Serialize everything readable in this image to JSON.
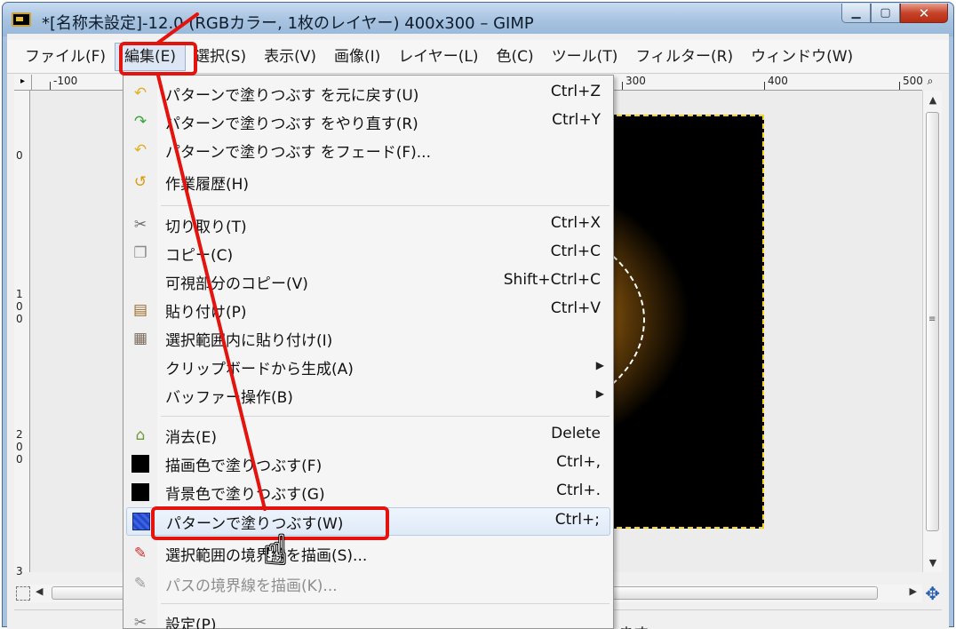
{
  "window": {
    "title": "*[名称未設定]-12.0 (RGBカラー, 1枚のレイヤー) 400x300 – GIMP",
    "minimize": "▁",
    "maximize": "▢",
    "close": "✕"
  },
  "menubar": [
    {
      "label": "ファイル(F)"
    },
    {
      "label": "編集(E)"
    },
    {
      "label": "選択(S)"
    },
    {
      "label": "表示(V)"
    },
    {
      "label": "画像(I)"
    },
    {
      "label": "レイヤー(L)"
    },
    {
      "label": "色(C)"
    },
    {
      "label": "ツール(T)"
    },
    {
      "label": "フィルター(R)"
    },
    {
      "label": "ウィンドウ(W)"
    }
  ],
  "ruler": {
    "top": [
      "-100",
      "300",
      "400",
      "500"
    ],
    "left": [
      "0",
      "1",
      "0",
      "0",
      "2",
      "0",
      "0",
      "3"
    ]
  },
  "status": {
    "text": "ます"
  },
  "edit_menu": [
    {
      "label": "パターンで塗りつぶす を元に戻す(U)",
      "shortcut": "Ctrl+Z",
      "icon": "undo-icon",
      "glyph": "↶",
      "color": "#e0b020"
    },
    {
      "label": "パターンで塗りつぶす をやり直す(R)",
      "shortcut": "Ctrl+Y",
      "icon": "redo-icon",
      "glyph": "↷",
      "color": "#3aa33a"
    },
    {
      "label": "パターンで塗りつぶす をフェード(F)...",
      "shortcut": "",
      "icon": "fade-icon",
      "glyph": "↶",
      "color": "#e0b020"
    },
    {
      "label": "作業履歴(H)",
      "shortcut": "",
      "icon": "history-icon",
      "glyph": "↺",
      "color": "#d89a10"
    },
    {
      "label": "切り取り(T)",
      "shortcut": "Ctrl+X",
      "icon": "cut-icon",
      "glyph": "✂",
      "color": "#6b6b6b"
    },
    {
      "label": "コピー(C)",
      "shortcut": "Ctrl+C",
      "icon": "copy-icon",
      "glyph": "❐",
      "color": "#8a8a8a"
    },
    {
      "label": "可視部分のコピー(V)",
      "shortcut": "Shift+Ctrl+C",
      "icon": "",
      "glyph": "",
      "color": ""
    },
    {
      "label": "貼り付け(P)",
      "shortcut": "Ctrl+V",
      "icon": "paste-icon",
      "glyph": "📋",
      "color": "#9a6a2a"
    },
    {
      "label": "選択範囲内に貼り付け(I)",
      "shortcut": "",
      "icon": "paste-into-icon",
      "glyph": "▦",
      "color": "#7a6a5a"
    },
    {
      "label": "クリップボードから生成(A)",
      "shortcut": "",
      "icon": "",
      "glyph": "",
      "color": "",
      "submenu": "▶"
    },
    {
      "label": "バッファー操作(B)",
      "shortcut": "",
      "icon": "",
      "glyph": "",
      "color": "",
      "submenu": "▶"
    },
    {
      "label": "消去(E)",
      "shortcut": "Delete",
      "icon": "clear-icon",
      "glyph": "⌂",
      "color": "#6a9a3a"
    },
    {
      "label": "描画色で塗りつぶす(F)",
      "shortcut": "Ctrl+,",
      "icon": "fg-fill-icon",
      "glyph": "",
      "color": "#000000"
    },
    {
      "label": "背景色で塗りつぶす(G)",
      "shortcut": "Ctrl+.",
      "icon": "bg-fill-icon",
      "glyph": "",
      "color": "#000000"
    },
    {
      "label": "パターンで塗りつぶす(W)",
      "shortcut": "Ctrl+;",
      "icon": "pattern-fill-icon",
      "glyph": "",
      "color": "#2f55d8"
    },
    {
      "label": "選択範囲の境界線を描画(S)...",
      "shortcut": "",
      "icon": "stroke-selection-icon",
      "glyph": "✎",
      "color": "#c8302a"
    },
    {
      "label": "パスの境界線を描画(K)...",
      "shortcut": "",
      "icon": "stroke-path-icon",
      "glyph": "✎",
      "color": "#9a9a9a",
      "disabled": true
    },
    {
      "label": "設定(P)",
      "shortcut": "",
      "icon": "preferences-icon",
      "glyph": "✂",
      "color": "#7a7a7a"
    }
  ],
  "annotation": {
    "color": "#e5130e"
  }
}
